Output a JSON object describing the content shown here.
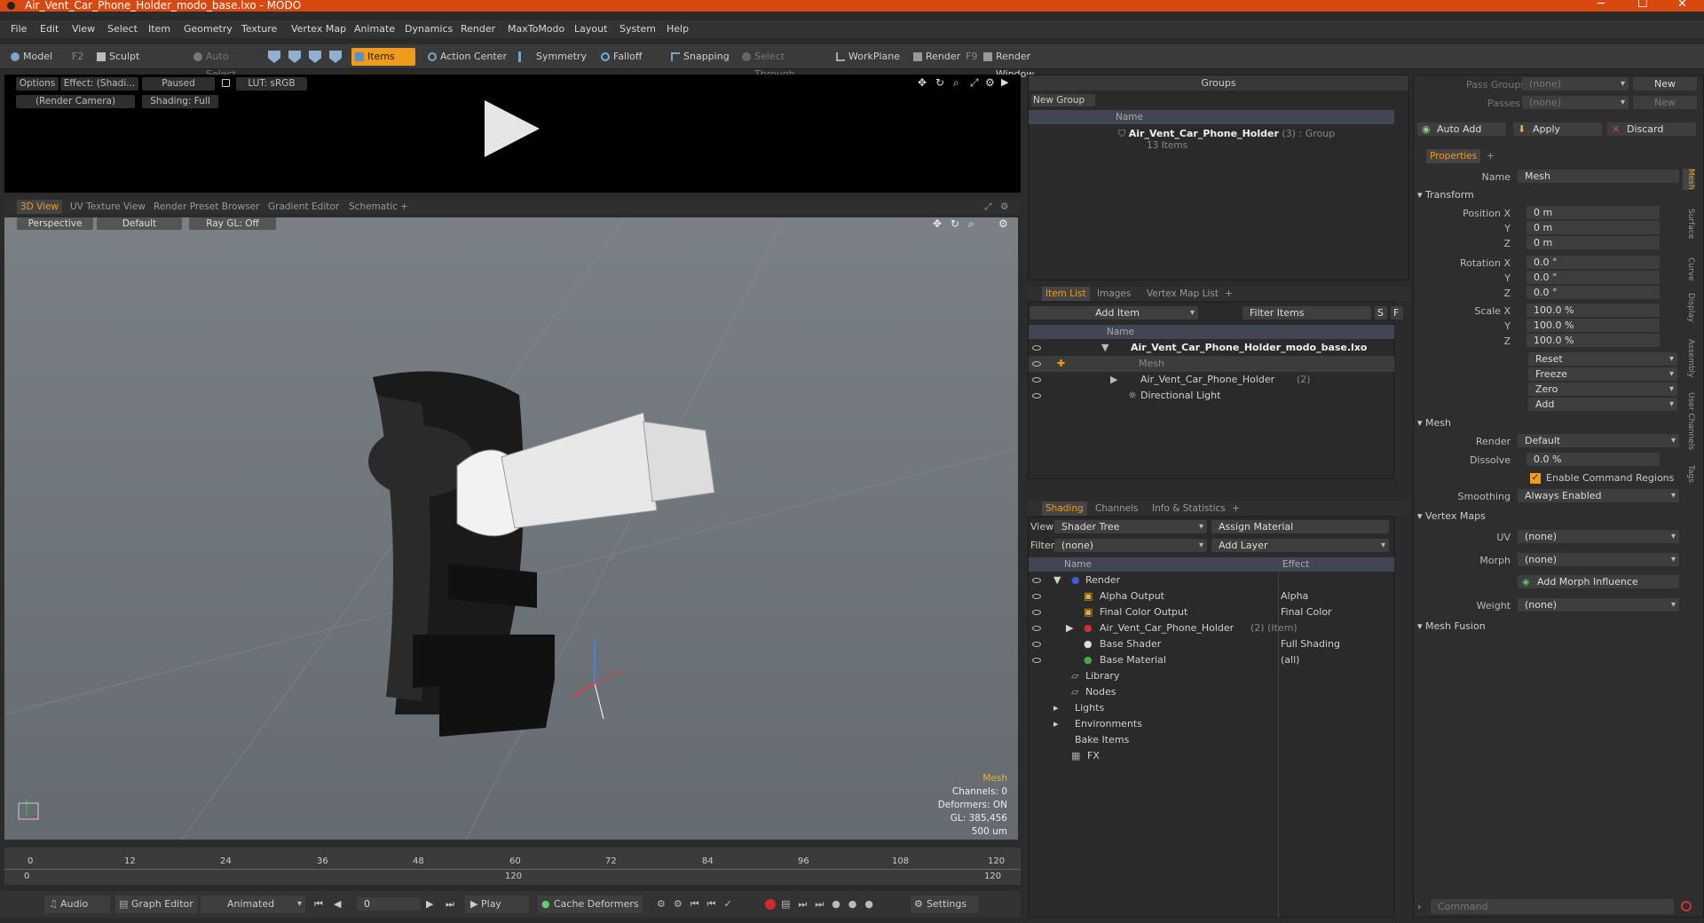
{
  "window": {
    "title": "Air_Vent_Car_Phone_Holder_modo_base.lxo - MODO"
  },
  "menu": [
    "File",
    "Edit",
    "View",
    "Select",
    "Item",
    "Geometry",
    "Texture",
    "Vertex Map",
    "Animate",
    "Dynamics",
    "Render",
    "MaxToModo",
    "Layout",
    "System",
    "Help"
  ],
  "toolbar": {
    "model": "Model",
    "model_key": "F2",
    "sculpt": "Sculpt",
    "auto_select": "Auto Select",
    "items": "Items",
    "action_center": "Action Center",
    "symmetry": "Symmetry",
    "falloff": "Falloff",
    "snapping": "Snapping",
    "select_through": "Select Through",
    "workplane": "WorkPlane",
    "render": "Render",
    "render_key": "F9",
    "render_window": "Render Window"
  },
  "preview": {
    "options": "Options",
    "effect": "Effect: (Shadi...",
    "paused": "Paused",
    "lut": "LUT: sRGB",
    "camera": "(Render Camera)",
    "shading": "Shading: Full"
  },
  "view_tabs": [
    "3D View",
    "UV Texture View",
    "Render Preset Browser",
    "Gradient Editor",
    "Schematic",
    "+"
  ],
  "viewport": {
    "perspective": "Perspective",
    "default": "Default",
    "raygl": "Ray GL: Off",
    "info_title": "Mesh",
    "channels": "Channels: 0",
    "deformers": "Deformers: ON",
    "gl": "GL: 385,456",
    "scale": "500 um"
  },
  "timeline": {
    "ticks": [
      "0",
      "12",
      "24",
      "36",
      "48",
      "60",
      "72",
      "84",
      "96",
      "108",
      "120"
    ],
    "lower": [
      "0",
      "120",
      "120"
    ]
  },
  "bottom": {
    "audio": "Audio",
    "graph_editor": "Graph Editor",
    "animated": "Animated",
    "frame": "0",
    "play": "Play",
    "cache": "Cache Deformers",
    "settings": "Settings"
  },
  "groups": {
    "title": "Groups",
    "new_group": "New Group",
    "col_name": "Name",
    "item_name": "Air_Vent_Car_Phone_Holder",
    "item_count": "(3)",
    "item_type": ": Group",
    "item_sub": "13 Items"
  },
  "itemlist": {
    "tabs": [
      "Item List",
      "Images",
      "Vertex Map List",
      "+"
    ],
    "add_item": "Add Item",
    "filter": "Filter Items",
    "s": "S",
    "f": "F",
    "col_name": "Name",
    "rows": [
      {
        "label": "Air_Vent_Car_Phone_Holder_modo_base.lxo"
      },
      {
        "label": "Mesh"
      },
      {
        "label": "Air_Vent_Car_Phone_Holder",
        "extra": "(2)"
      },
      {
        "label": "Directional Light"
      }
    ]
  },
  "shading": {
    "tabs": [
      "Shading",
      "Channels",
      "Info & Statistics",
      "+"
    ],
    "view_label": "View",
    "view_value": "Shader Tree",
    "assign": "Assign Material",
    "filter_label": "Filter",
    "filter_value": "(none)",
    "add_layer": "Add Layer",
    "col_name": "Name",
    "col_effect": "Effect",
    "rows": [
      {
        "name": "Render",
        "effect": ""
      },
      {
        "name": "Alpha Output",
        "effect": "Alpha"
      },
      {
        "name": "Final Color Output",
        "effect": "Final Color"
      },
      {
        "name": "Air_Vent_Car_Phone_Holder",
        "extra": "(2) (Item)",
        "effect": ""
      },
      {
        "name": "Base Shader",
        "effect": "Full Shading"
      },
      {
        "name": "Base Material",
        "effect": "(all)"
      },
      {
        "name": "Library",
        "effect": ""
      },
      {
        "name": "Nodes",
        "effect": ""
      },
      {
        "name": "Lights",
        "effect": ""
      },
      {
        "name": "Environments",
        "effect": ""
      },
      {
        "name": "Bake Items",
        "effect": ""
      },
      {
        "name": "FX",
        "effect": ""
      }
    ]
  },
  "passes": {
    "pass_groups": "Pass Groups",
    "passes": "Passes",
    "none": "(none)",
    "new": "New",
    "auto_add": "Auto Add",
    "apply": "Apply",
    "discard": "Discard"
  },
  "properties": {
    "tab": "Properties",
    "name_label": "Name",
    "name_value": "Mesh",
    "transform": "Transform",
    "position_label": "Position X",
    "rotation_label": "Rotation X",
    "scale_label": "Scale X",
    "y": "Y",
    "z": "Z",
    "pos": [
      "0 m",
      "0 m",
      "0 m"
    ],
    "rot": [
      "0.0 °",
      "0.0 °",
      "0.0 °"
    ],
    "scl": [
      "100.0 %",
      "100.0 %",
      "100.0 %"
    ],
    "reset": "Reset",
    "freeze": "Freeze",
    "zero": "Zero",
    "add": "Add",
    "mesh": "Mesh",
    "render_label": "Render",
    "render_value": "Default",
    "dissolve_label": "Dissolve",
    "dissolve_value": "0.0 %",
    "enable_cmd": "Enable Command Regions",
    "smoothing_label": "Smoothing",
    "smoothing_value": "Always Enabled",
    "vertex_maps": "Vertex Maps",
    "uv_label": "UV",
    "morph_label": "Morph",
    "none": "(none)",
    "add_morph": "Add Morph Influence",
    "weight_label": "Weight",
    "mesh_fusion": "Mesh Fusion",
    "side_tabs": [
      "Mesh",
      "Surface",
      "Curve",
      "Display",
      "Assembly",
      "User Channels",
      "Tags"
    ]
  },
  "command": {
    "placeholder": "Command"
  }
}
